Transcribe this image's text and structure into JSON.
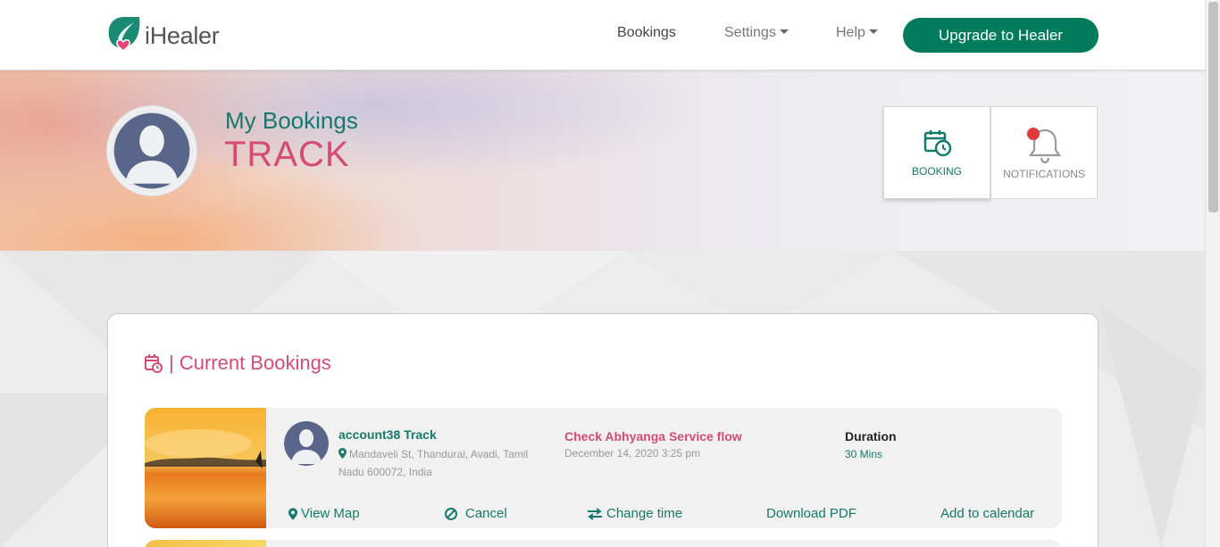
{
  "brand": {
    "name": "iHealer"
  },
  "nav": {
    "bookings": "Bookings",
    "settings": "Settings",
    "help": "Help",
    "upgrade": "Upgrade to Healer"
  },
  "hero": {
    "subtitle": "My Bookings",
    "title": "TRACK"
  },
  "tiles": {
    "booking": "BOOKING",
    "notifications": "NOTIFICATIONS"
  },
  "section": {
    "title": "| Current Bookings"
  },
  "booking": {
    "account": "account38 Track",
    "address": "Mandaveli St, Thandurai, Avadi, Tamil Nadu 600072, India",
    "service": "Check Abhyanga Service flow",
    "date": "December 14, 2020 3:25 pm",
    "duration_label": "Duration",
    "duration_value": "30 Mins",
    "actions": {
      "view_map": "View Map",
      "cancel": "Cancel",
      "change_time": "Change time",
      "download_pdf": "Download PDF",
      "add_calendar": "Add to calendar"
    }
  },
  "colors": {
    "brand_green": "#007c5d",
    "accent_pink": "#d64b74",
    "text_green": "#157a6b",
    "notification_dot": "#e03a3a"
  }
}
